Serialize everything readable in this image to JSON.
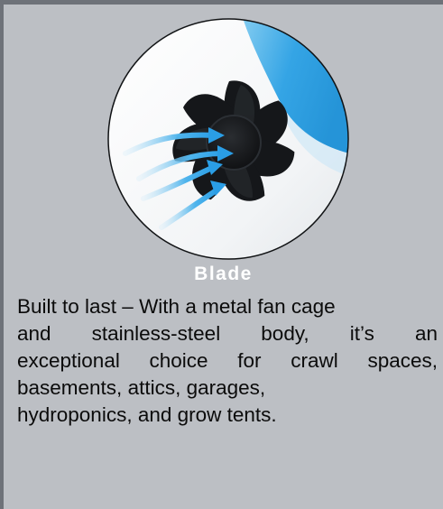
{
  "feature": {
    "caption": "Blade",
    "description_lines": [
      "Built to last – With a metal fan cage",
      "and stainless-steel body, it’s an",
      "exceptional choice for crawl spaces,",
      "basements, attics, garages,",
      "hydroponics, and grow tents."
    ],
    "image_icon": "fan-blade-airflow-icon",
    "colors": {
      "background": "#bcbfc4",
      "border": "#6e7279",
      "caption": "#ffffff",
      "airflow": "#3aa6e6",
      "blade": "#16181b"
    }
  }
}
